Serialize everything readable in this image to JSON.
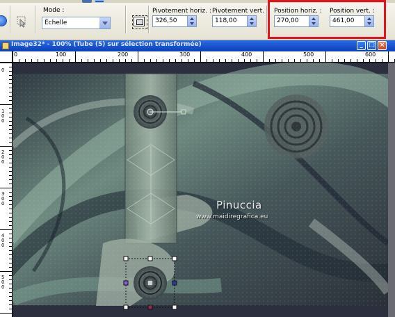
{
  "toolbar": {
    "mode_label": "Mode :",
    "mode_value": "Échelle",
    "pivot_h_label": "Pivotement horiz. :",
    "pivot_h_value": "326,50",
    "pivot_v_label": "Pivotement vert. :",
    "pivot_v_value": "118,00",
    "pos_h_label": "Position horiz. :",
    "pos_h_value": "270,00",
    "pos_v_label": "Position vert. :",
    "pos_v_value": "461,00"
  },
  "document": {
    "title": "Image32* - 100% (Tube (5) sur sélection transformée)"
  },
  "ruler": {
    "h_labels": [
      "0",
      "100",
      "200",
      "300",
      "400",
      "500",
      "600"
    ],
    "v_labels": [
      "0",
      "1 0 0",
      "2 0 0",
      "3 0 0",
      "4 0 0",
      "5 0 0"
    ]
  },
  "canvas": {
    "watermark_name": "Pinuccia",
    "watermark_url": "www.maidiregrafica.eu"
  },
  "colors": {
    "highlight": "#e0141a",
    "titlebar": "#0a3fb8",
    "canvas_dark": "#2f3742",
    "canvas_green": "#5d8578"
  }
}
